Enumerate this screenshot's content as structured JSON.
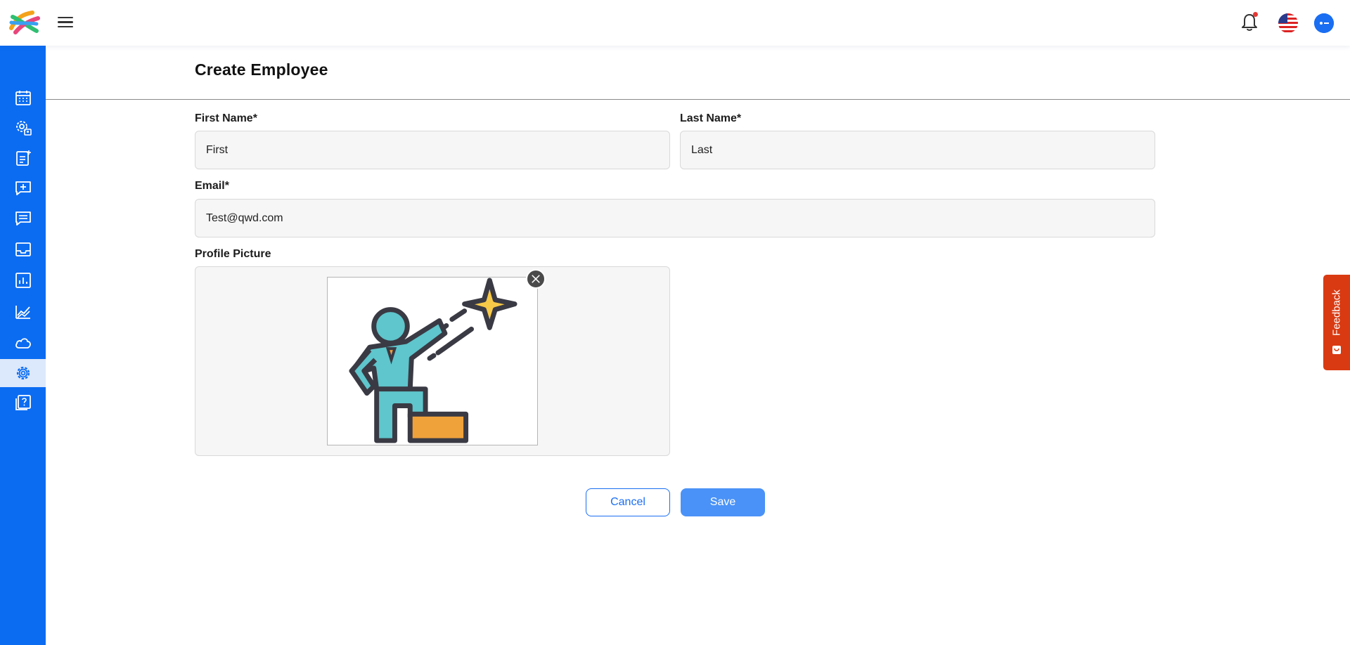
{
  "header": {
    "logo_name": "app-logo",
    "notification_count_dot": true,
    "language": "US"
  },
  "sidebar": {
    "items": [
      {
        "icon": "calendar-icon"
      },
      {
        "icon": "user-settings-icon"
      },
      {
        "icon": "document-add-icon"
      },
      {
        "icon": "chat-add-icon"
      },
      {
        "icon": "messages-icon"
      },
      {
        "icon": "inbox-icon"
      },
      {
        "icon": "report-icon"
      },
      {
        "icon": "analytics-icon"
      },
      {
        "icon": "cloud-icon"
      },
      {
        "icon": "settings-icon",
        "active": true
      },
      {
        "icon": "help-icon"
      }
    ]
  },
  "page": {
    "title": "Create Employee"
  },
  "form": {
    "first_name": {
      "label": "First Name*",
      "value": "First"
    },
    "last_name": {
      "label": "Last Name*",
      "value": "Last"
    },
    "email": {
      "label": "Email*",
      "value": "Test@qwd.com"
    },
    "profile_picture": {
      "label": "Profile Picture"
    },
    "cancel_label": "Cancel",
    "save_label": "Save"
  },
  "feedback": {
    "label": "Feedback"
  },
  "colors": {
    "sidebar": "#0b6cf2",
    "accent": "#1a6ef2",
    "save_button": "#4a92f7",
    "feedback": "#d93a12"
  }
}
